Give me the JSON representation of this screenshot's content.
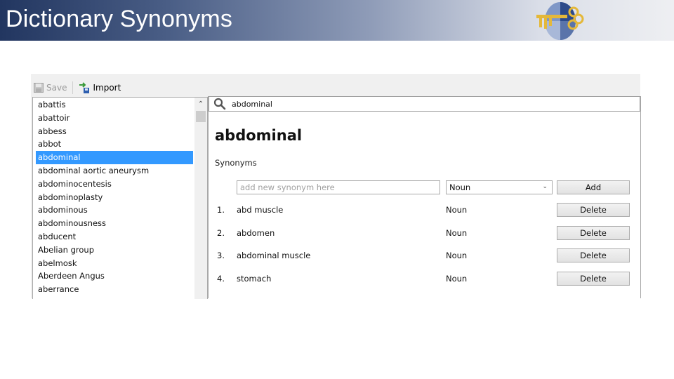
{
  "slide": {
    "title": "Dictionary Synonyms",
    "logo": "key-globe-logo"
  },
  "toolbar": {
    "save_label": "Save",
    "save_enabled": false,
    "import_label": "Import"
  },
  "word_list": {
    "items": [
      {
        "label": "abattis",
        "selected": false
      },
      {
        "label": "abattoir",
        "selected": false
      },
      {
        "label": "abbess",
        "selected": false
      },
      {
        "label": "abbot",
        "selected": false
      },
      {
        "label": "abdominal",
        "selected": true
      },
      {
        "label": "abdominal aortic aneurysm",
        "selected": false
      },
      {
        "label": "abdominocentesis",
        "selected": false
      },
      {
        "label": "abdominoplasty",
        "selected": false
      },
      {
        "label": "abdominous",
        "selected": false
      },
      {
        "label": "abdominousness",
        "selected": false
      },
      {
        "label": "abducent",
        "selected": false
      },
      {
        "label": "Abelian group",
        "selected": false
      },
      {
        "label": "abelmosk",
        "selected": false
      },
      {
        "label": "Aberdeen Angus",
        "selected": false
      },
      {
        "label": "aberrance",
        "selected": false
      }
    ],
    "scroll_up_icon": "chevron-up-icon"
  },
  "detail": {
    "search_value": "abdominal",
    "search_icon": "search-icon",
    "headword": "abdominal",
    "synonyms_label": "Synonyms",
    "new_synonym_placeholder": "add new synonym here",
    "new_synonym_value": "",
    "pos_selected": "Noun",
    "add_label": "Add",
    "synonyms": [
      {
        "num": "1.",
        "word": "abd muscle",
        "pos": "Noun",
        "delete_label": "Delete"
      },
      {
        "num": "2.",
        "word": "abdomen",
        "pos": "Noun",
        "delete_label": "Delete"
      },
      {
        "num": "3.",
        "word": "abdominal muscle",
        "pos": "Noun",
        "delete_label": "Delete"
      },
      {
        "num": "4.",
        "word": "stomach",
        "pos": "Noun",
        "delete_label": "Delete"
      }
    ]
  }
}
